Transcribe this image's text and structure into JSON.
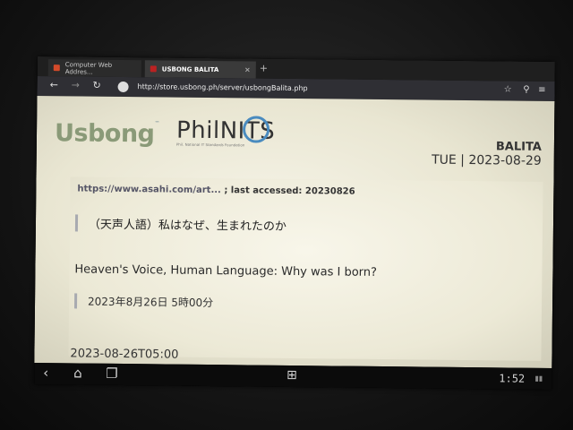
{
  "browser": {
    "tabs": [
      {
        "label": "Computer Web Addres...",
        "active": false
      },
      {
        "label": "USBONG BALITA",
        "active": true
      }
    ],
    "tab_close": "×",
    "new_tab": "+",
    "url": "http://store.usbong.ph/server/usbongBalita.php",
    "icons": {
      "back": "back-arrow-icon",
      "forward": "forward-arrow-icon",
      "reload": "reload-icon",
      "site": "globe-icon",
      "bookmark": "star-icon",
      "search": "search-icon",
      "menu": "menu-icon"
    }
  },
  "header": {
    "usbong_logo": "Usbong",
    "philnits_logo": "PhilNITS",
    "philnits_sub": "Phil. National IT Standards Foundation",
    "title": "BALITA",
    "date": "TUE | 2023-08-29"
  },
  "article": {
    "source_url": "https://www.asahi.com/art...",
    "source_accessed": " ; last accessed: 20230826",
    "jp_title": "（天声人語）私はなぜ、生まれたのか",
    "en_title": "Heaven's Voice, Human Language: Why was I born?",
    "jp_date": "2023年8月26日 5時00分",
    "iso_date": "2023-08-26T05:00"
  },
  "system_bar": {
    "clock": "1:52",
    "icons": {
      "back": "back-icon",
      "home": "home-icon",
      "recent": "recent-apps-icon",
      "apps": "apps-grid-icon"
    }
  },
  "colors": {
    "usbong_green": "#8a9a78",
    "philnits_blue": "#4a8bbf",
    "page_background": "#f6f4e8"
  }
}
